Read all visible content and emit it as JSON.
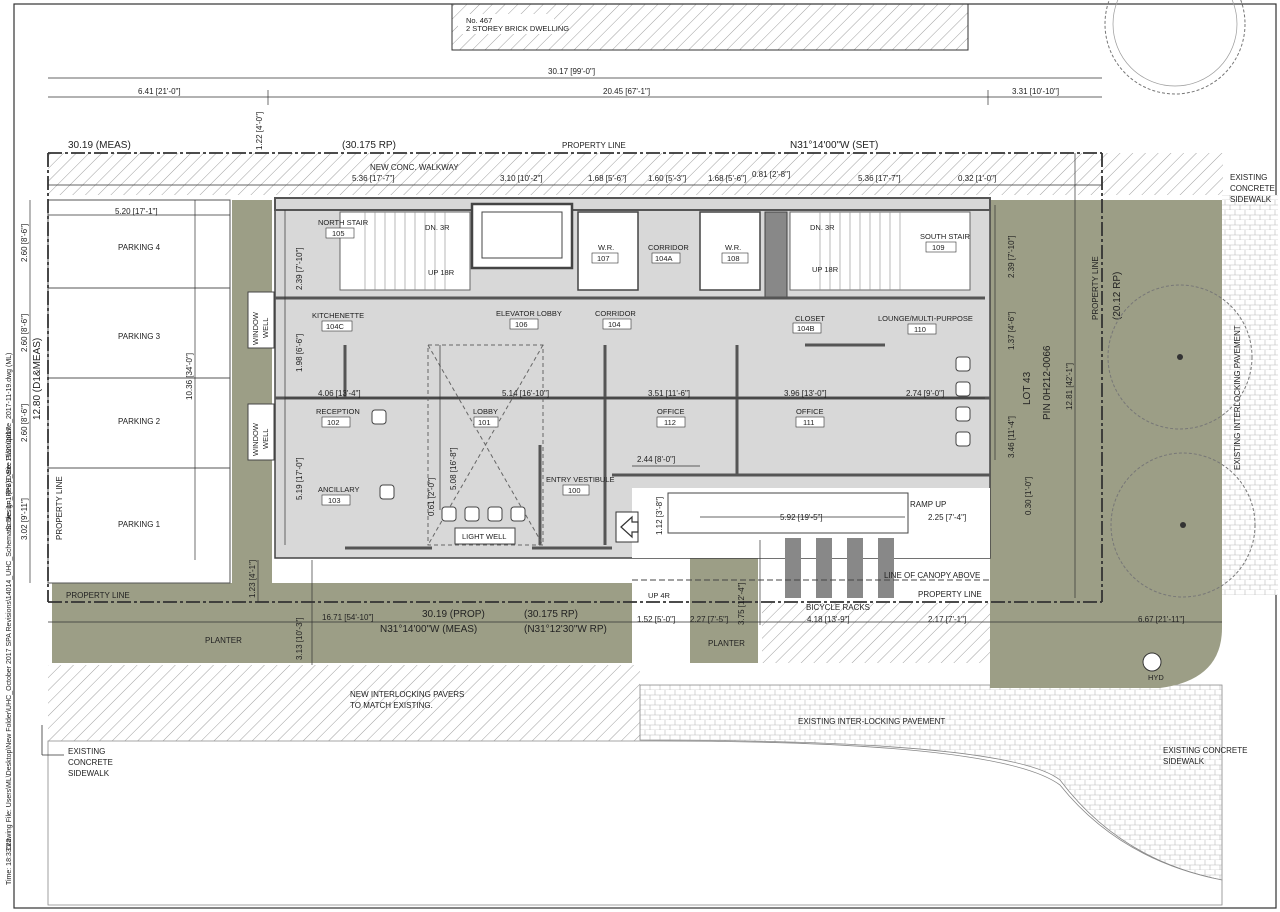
{
  "title_block": {
    "drawing_file": "Drawing File: Users\\ML\\Desktop\\New Folder\\UHC_October 2017 SPA Revisions\\14014_UHC_Schematic Design_Rev 9_Site Plan update_2017-11-19.dwg (ML)",
    "scale": "Scale: 1=1 (PS)",
    "date": "Date: 11/20/2017",
    "time": "Time: 18:33:22"
  },
  "neighbour": {
    "line1": "No. 467",
    "line2": "2 STOREY BRICK DWELLING"
  },
  "dimensions": {
    "overall": "30.17 [99'-0\"]",
    "left": "6.41 [21'-0\"]",
    "middle": "20.45 [67'-1\"]",
    "right": "3.31 [10'-10\"]",
    "setback_top": "1.22 [4'-0\"]",
    "meas_top": "30.19 (MEAS)",
    "rp_top": "(30.175 RP)",
    "bearing_top": "N31°14'00\"W (SET)",
    "walk1": "5.36 [17'-7\"]",
    "walk2": "3.10 [10'-2\"]",
    "walk3": "1.68 [5'-6\"]",
    "walk4": "1.60 [5'-3\"]",
    "walk5": "1.68 [5'-6\"]",
    "walk6": "0.81 [2'-8\"]",
    "walk7": "5.36 [17'-7\"]",
    "walk8": "0.32 [1'-0\"]",
    "park_w": "5.20 [17'-1\"]",
    "park4": "2.60 [8'-6\"]",
    "park3": "2.60 [8'-6\"]",
    "park2": "2.60 [8'-6\"]",
    "park1": "3.02 [9'-11\"]",
    "lot_depth_left": "12.80 (D1&MEAS)",
    "depth_inner": "10.36 [34'-0\"]",
    "ns_h": "2.39 [7'-10\"]",
    "kit_h": "1.98 [6'-6\"]",
    "rec_h": "5.19 [17'-0\"]",
    "d406": "4.06 [13'-4\"]",
    "d514": "5.14 [16'-10\"]",
    "d351": "3.51 [11'-6\"]",
    "d396": "3.96 [13'-0\"]",
    "d274": "2.74 [9'-0\"]",
    "lobby_h": "5.08 [16'-8\"]",
    "d061": "0.61 [2'-0\"]",
    "d244": "2.44 [8'-0\"]",
    "d112": "1.12 [3'-8\"]",
    "d592": "5.92 [19'-5\"]",
    "d225": "2.25 [7'-4\"]",
    "d030": "0.30 [1'-0\"]",
    "ss_h": "2.39 [7'-10\"]",
    "d137": "1.37 [4'-6\"]",
    "d346": "3.46 [11'-4\"]",
    "lot_depth_right": "12.81 [42'-1\"]",
    "d123": "1.23 [4'-1\"]",
    "d313": "3.13 [10'-3\"]",
    "d1671": "16.71 [54'-10\"]",
    "meas_bot": "30.19 (PROP)",
    "rp_bot": "(30.175 RP)",
    "bearing_bot": "N31°14'00\"W (MEAS)",
    "rp_bot2": "(N31°12'30\"W RP)",
    "d152": "1.52 [5'-0\"]",
    "d227": "2.27 [7'-5\"]",
    "d375": "3.75 [12'-4\"]",
    "d418": "4.18 [13'-9\"]",
    "d217": "2.17 [7'-1\"]",
    "d667": "6.67 [21'-11\"]",
    "lot_right_rp": "(20.12 RP)"
  },
  "labels": {
    "property_line_top": "PROPERTY LINE",
    "property_line_left": "PROPERTY LINE",
    "property_line_bl": "PROPERTY LINE",
    "property_line_br": "PROPERTY LINE",
    "property_line_right": "PROPERTY LINE",
    "new_walkway": "NEW CONC. WALKWAY",
    "existing_concrete_tr": "EXISTING CONCRETE SIDEWALK",
    "existing_interlocking_pavement_r": "EXISTING INTERLOCKING PAVEMENT",
    "parking4": "PARKING 4",
    "parking3": "PARKING 3",
    "parking2": "PARKING 2",
    "parking1": "PARKING 1",
    "window_well": "WINDOW WELL",
    "light_well": "LIGHT WELL",
    "ramp_up": "RAMP UP",
    "line_canopy": "LINE OF CANOPY ABOVE",
    "bicycle_racks": "BICYCLE RACKS",
    "planter": "PLANTER",
    "new_pavers_1": "NEW INTERLOCKING PAVERS",
    "new_pavers_2": "TO MATCH EXISTING.",
    "existing_interlocking": "EXISTING INTER-LOCKING PAVEMENT",
    "existing_concrete_bl_1": "EXISTING",
    "existing_concrete_bl_2": "CONCRETE",
    "existing_concrete_bl_3": "SIDEWALK",
    "existing_concrete_br": "EXISTING CONCRETE SIDEWALK",
    "up4r": "UP 4R",
    "dn3r": "DN. 3R",
    "up18r": "UP 18R",
    "lot": "LOT 43",
    "pin": "PIN 0H212-0066"
  },
  "rooms": [
    {
      "name": "NORTH STAIR",
      "num": "105"
    },
    {
      "name": "W.R.",
      "num": "107"
    },
    {
      "name": "CORRIDOR",
      "num": "104A"
    },
    {
      "name": "W.R.",
      "num": "108"
    },
    {
      "name": "SOUTH STAIR",
      "num": "109"
    },
    {
      "name": "KITCHENETTE",
      "num": "104C"
    },
    {
      "name": "ELEVATOR LOBBY",
      "num": "106"
    },
    {
      "name": "CORRIDOR",
      "num": "104"
    },
    {
      "name": "CLOSET",
      "num": "104B"
    },
    {
      "name": "LOUNGE/MULTI-PURPOSE",
      "num": "110"
    },
    {
      "name": "RECEPTION",
      "num": "102"
    },
    {
      "name": "LOBBY",
      "num": "101"
    },
    {
      "name": "OFFICE",
      "num": "112"
    },
    {
      "name": "OFFICE",
      "num": "111"
    },
    {
      "name": "ANCILLARY",
      "num": "103"
    },
    {
      "name": "ENTRY VESTIBULE",
      "num": "100"
    }
  ],
  "colors": {
    "site_green": "#9c9e86",
    "floor_grey": "#d8d8d8",
    "wall": "#555555",
    "ink": "#222222"
  }
}
